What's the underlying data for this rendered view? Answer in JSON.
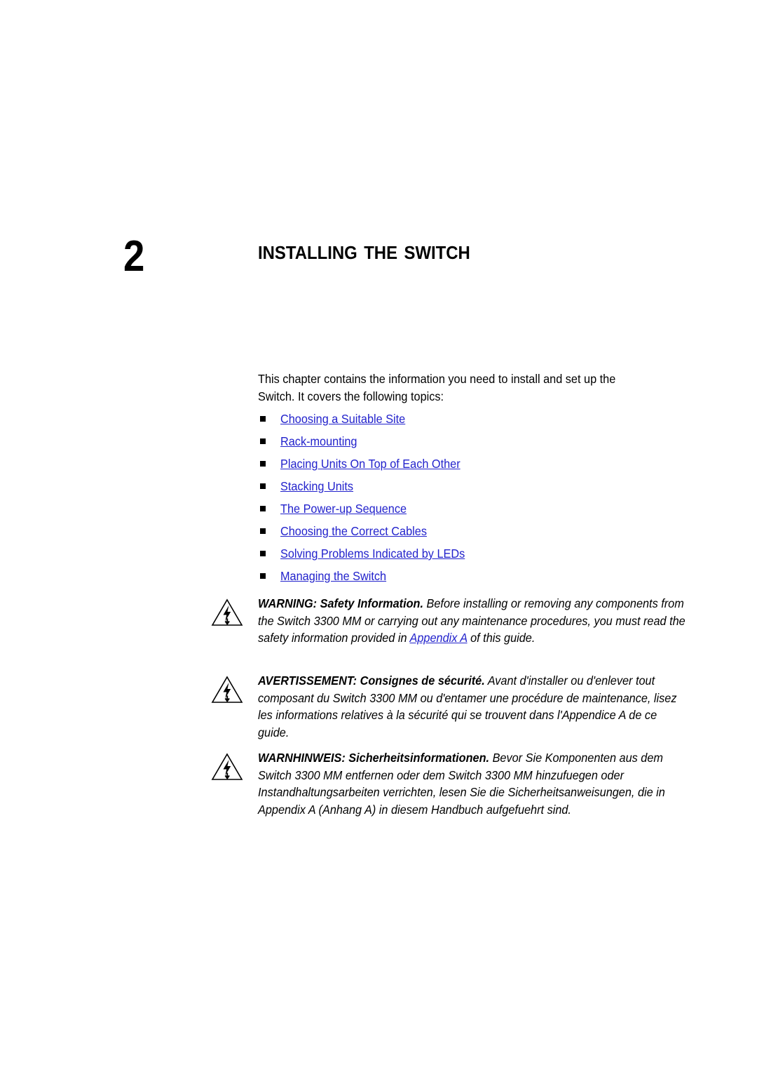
{
  "document": {
    "type": "manual-page",
    "background_color": "#ffffff",
    "link_color": "#2222cc",
    "text_color": "#000000"
  },
  "chapter": {
    "number": "2",
    "title": "Installing the Switch"
  },
  "intro": {
    "paragraph": "This chapter contains the information you need to install and set up the Switch. It covers the following topics:"
  },
  "toc": {
    "bullet_icon": "square-bullet-icon",
    "items": [
      {
        "label": "Choosing a Suitable Site"
      },
      {
        "label": "Rack-mounting"
      },
      {
        "label": "Placing Units On Top of Each Other"
      },
      {
        "label": "Stacking Units"
      },
      {
        "label": "The Power-up Sequence"
      },
      {
        "label": "Choosing the Correct Cables"
      },
      {
        "label": "Solving Problems Indicated by LEDs"
      },
      {
        "label": "Managing the Switch"
      }
    ]
  },
  "warnings": [
    {
      "id": "warning-en",
      "icon": "warning-lightning-triangle-icon",
      "lead": "WARNING: Safety Information.",
      "body_before_link": " Before installing or removing any components from the Switch 3300 MM or carrying out any maintenance procedures, you must read the safety information provided in ",
      "link": "Appendix A",
      "body_after_link": " of this guide."
    },
    {
      "id": "warning-fr",
      "icon": "warning-lightning-triangle-icon",
      "lead": "AVERTISSEMENT: Consignes de sécurité.",
      "body_before_link": " Avant d'installer ou d'enlever tout composant du Switch 3300 MM ou d'entamer une procédure de maintenance, lisez les informations relatives à la sécurité qui se trouvent dans l'Appendice A de ce guide.",
      "link": "",
      "body_after_link": ""
    },
    {
      "id": "warning-de",
      "icon": "warning-lightning-triangle-icon",
      "lead": "WARNHINWEIS: Sicherheitsinformationen.",
      "body_before_link": " Bevor Sie Komponenten aus dem Switch 3300 MM entfernen oder dem Switch 3300 MM hinzufuegen oder Instandhaltungsarbeiten verrichten, lesen Sie die Sicherheitsanweisungen, die in Appendix A (Anhang A) in diesem Handbuch aufgefuehrt sind.",
      "link": "",
      "body_after_link": ""
    }
  ]
}
